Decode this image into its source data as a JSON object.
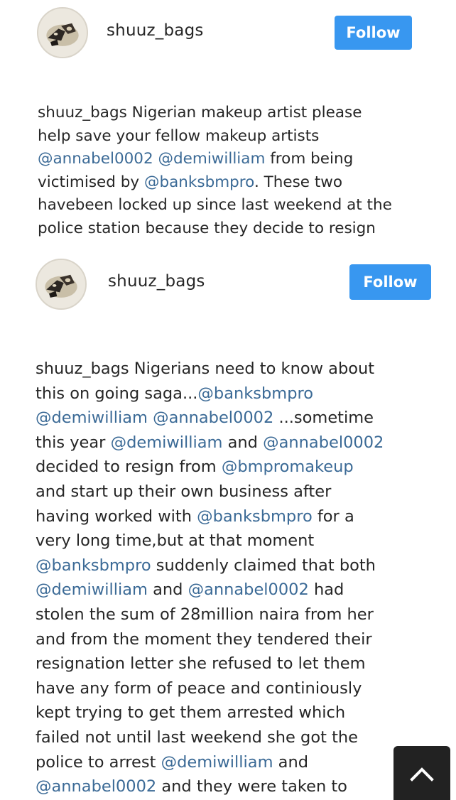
{
  "posts": [
    {
      "username": "shuuz_bags",
      "follow_label": "Follow",
      "caption_lines": [
        [
          {
            "t": "shuuz_bags",
            "k": "user"
          },
          {
            "t": " Nigerian makeup artist please",
            "k": "text"
          }
        ],
        [
          {
            "t": "help save your fellow makeup artists",
            "k": "text"
          }
        ],
        [
          {
            "t": "@annabel0002",
            "k": "mention"
          },
          {
            "t": " ",
            "k": "text"
          },
          {
            "t": "@demiwilliam",
            "k": "mention"
          },
          {
            "t": " from being",
            "k": "text"
          }
        ],
        [
          {
            "t": "victimised by ",
            "k": "text"
          },
          {
            "t": "@banksbmpro",
            "k": "mention"
          },
          {
            "t": ". These two",
            "k": "text"
          }
        ],
        [
          {
            "t": "havebeen locked up since last weekend at the",
            "k": "text"
          }
        ],
        [
          {
            "t": "police station because they decide to resign",
            "k": "text"
          }
        ]
      ]
    },
    {
      "username": "shuuz_bags",
      "follow_label": "Follow",
      "caption_lines": [
        [
          {
            "t": "shuuz_bags",
            "k": "user"
          },
          {
            "t": " Nigerians need to know about",
            "k": "text"
          }
        ],
        [
          {
            "t": "this on going saga...",
            "k": "text"
          },
          {
            "t": "@banksbmpro",
            "k": "mention"
          }
        ],
        [
          {
            "t": "@demiwilliam",
            "k": "mention"
          },
          {
            "t": " ",
            "k": "text"
          },
          {
            "t": "@annabel0002",
            "k": "mention"
          },
          {
            "t": " ...sometime",
            "k": "text"
          }
        ],
        [
          {
            "t": "this year ",
            "k": "text"
          },
          {
            "t": "@demiwilliam",
            "k": "mention"
          },
          {
            "t": " and ",
            "k": "text"
          },
          {
            "t": "@annabel0002",
            "k": "mention"
          }
        ],
        [
          {
            "t": "decided to resign from ",
            "k": "text"
          },
          {
            "t": "@bmpromakeup",
            "k": "mention"
          }
        ],
        [
          {
            "t": "and start up their own business after",
            "k": "text"
          }
        ],
        [
          {
            "t": "having worked with ",
            "k": "text"
          },
          {
            "t": "@banksbmpro",
            "k": "mention"
          },
          {
            "t": " for a",
            "k": "text"
          }
        ],
        [
          {
            "t": "very long time,but at that moment",
            "k": "text"
          }
        ],
        [
          {
            "t": "@banksbmpro",
            "k": "mention"
          },
          {
            "t": " suddenly claimed that both",
            "k": "text"
          }
        ],
        [
          {
            "t": "@demiwilliam",
            "k": "mention"
          },
          {
            "t": " and ",
            "k": "text"
          },
          {
            "t": "@annabel0002",
            "k": "mention"
          },
          {
            "t": " had",
            "k": "text"
          }
        ],
        [
          {
            "t": "stolen the sum of 28million naira from her",
            "k": "text"
          }
        ],
        [
          {
            "t": "and from the moment they tendered their",
            "k": "text"
          }
        ],
        [
          {
            "t": "resignation letter she refused to let them",
            "k": "text"
          }
        ],
        [
          {
            "t": "have any form of peace and continiously",
            "k": "text"
          }
        ],
        [
          {
            "t": "kept trying to get them arrested which",
            "k": "text"
          }
        ],
        [
          {
            "t": "failed not until last weekend she got the",
            "k": "text"
          }
        ],
        [
          {
            "t": "police to arrest ",
            "k": "text"
          },
          {
            "t": "@demiwilliam",
            "k": "mention"
          },
          {
            "t": " and",
            "k": "text"
          }
        ],
        [
          {
            "t": "@annabel0002",
            "k": "mention"
          },
          {
            "t": " and they were taken to",
            "k": "text"
          }
        ]
      ]
    }
  ],
  "colors": {
    "follow_button": "#3897f0",
    "mention": "#3b6a96",
    "text": "#262626",
    "scroll_button": "#222222"
  },
  "scroll_top": {
    "icon": "chevron-up-icon"
  }
}
